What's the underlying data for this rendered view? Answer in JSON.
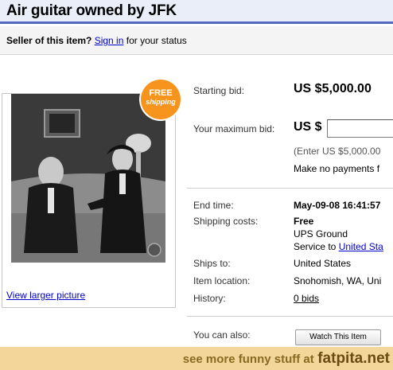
{
  "header": {
    "title": "Air guitar owned by JFK"
  },
  "seller": {
    "prefix": "Seller of this item?",
    "sign_in": "Sign in",
    "suffix": "for your status"
  },
  "badge": {
    "line1": "FREE",
    "line2": "shipping"
  },
  "picture": {
    "view_larger": "View larger picture"
  },
  "bid": {
    "starting_label": "Starting bid:",
    "starting_value": "US $5,000.00",
    "max_label": "Your maximum bid:",
    "max_prefix": "US $",
    "max_input_value": "",
    "hint": "(Enter US $5,000.00",
    "payments": "Make no payments f"
  },
  "details": {
    "end_time_label": "End time:",
    "end_time_value": "May-09-08 16:41:57",
    "shipping_label": "Shipping costs:",
    "shipping_cost": "Free",
    "shipping_method": "UPS Ground",
    "service_prefix": "Service to",
    "service_link": "United Sta",
    "ships_to_label": "Ships to:",
    "ships_to_value": "United States",
    "location_label": "Item location:",
    "location_value": "Snohomish, WA, Uni",
    "history_label": "History:",
    "history_value": "0 bids",
    "also_label": "You can also:",
    "watch_button": "Watch This Item"
  },
  "footer": {
    "prefix": "see more funny stuff at",
    "site": "fatpita.net"
  },
  "colors": {
    "title_bar_bg": "#e9eef9",
    "title_border": "#5269c2",
    "badge": "#f7941d",
    "link": "#0000cc",
    "footer_bg": "#f2d69a"
  }
}
